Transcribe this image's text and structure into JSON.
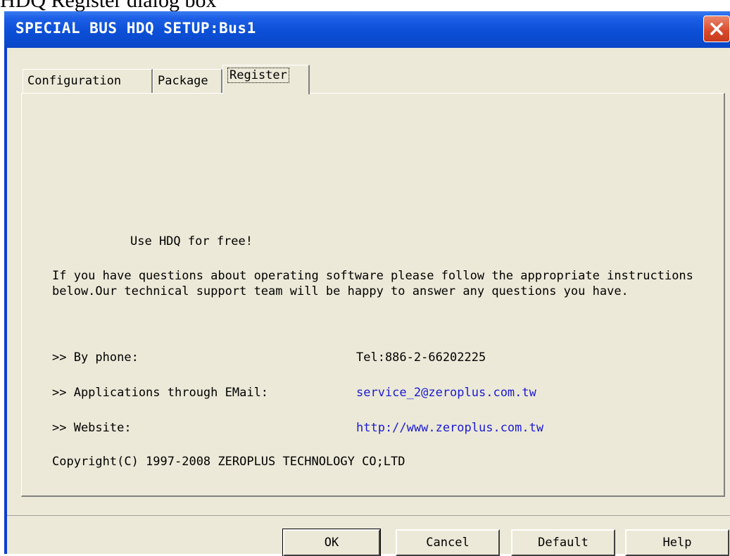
{
  "caption": "HDQ Register dialog box",
  "window": {
    "title": "SPECIAL BUS HDQ SETUP:Bus1"
  },
  "tabs": [
    {
      "label": "Configuration"
    },
    {
      "label": "Package"
    },
    {
      "label": "Register",
      "selected": true
    }
  ],
  "register": {
    "headline": "Use HDQ for free!",
    "intro": "If you have questions about operating software please follow the appropriate instructions below.Our technical support team will be happy to answer any questions you have.",
    "contacts": [
      {
        "label": ">> By phone:",
        "value": "Tel:886-2-66202225"
      },
      {
        "label": ">> Applications through EMail:",
        "value": "service_2@zeroplus.com.tw"
      },
      {
        "label": ">> Website:",
        "value": "http://www.zeroplus.com.tw"
      }
    ],
    "copyright": "Copyright(C) 1997-2008 ZEROPLUS TECHNOLOGY CO;LTD"
  },
  "buttons": {
    "ok": "OK",
    "cancel": "Cancel",
    "default": "Default",
    "help": "Help"
  },
  "colors": {
    "titlebar": "#0a46c8",
    "dialog_bg": "#ece9d8",
    "link": "#1a1ad0",
    "close": "#d9482a"
  },
  "icons": {
    "close": "close-icon"
  }
}
